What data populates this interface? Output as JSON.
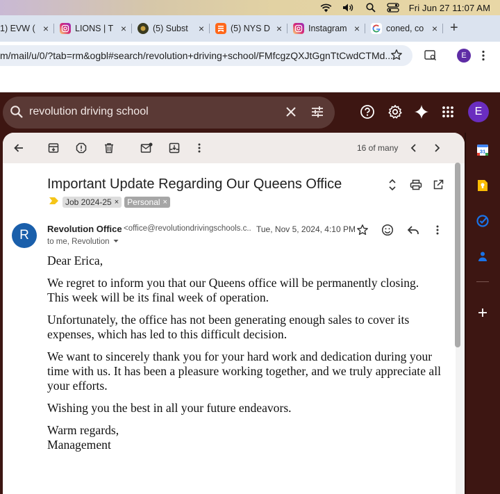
{
  "menubar": {
    "clock": "Fri Jun 27  11:07 AM"
  },
  "tabs": [
    {
      "label": "1) EVW (",
      "favicon": "",
      "favicon_color": "",
      "close": "×"
    },
    {
      "label": "LIONS | T",
      "favicon": "instagram-icon",
      "favicon_color": "#d6249f",
      "close": "×"
    },
    {
      "label": "(5) Subst",
      "favicon": "circle-logo-icon",
      "favicon_color": "#3a3a20",
      "close": "×"
    },
    {
      "label": "(5) NYS D",
      "favicon": "substack-icon",
      "favicon_color": "#ff6719",
      "close": "×"
    },
    {
      "label": "Instagram",
      "favicon": "instagram-icon",
      "favicon_color": "#d6249f",
      "close": "×"
    },
    {
      "label": "coned, co",
      "favicon": "google-icon",
      "favicon_color": "#4285f4",
      "close": "×"
    }
  ],
  "address": {
    "url": "m/mail/u/0/?tab=rm&ogbl#search/revolution+driving+school/FMfcgzQXJtGgnTtCwdCTMd..."
  },
  "profile": {
    "initial": "E"
  },
  "search": {
    "query": "revolution driving school"
  },
  "toolbar": {
    "pager": "16 of many"
  },
  "email": {
    "subject": "Important Update Regarding Our Queens Office",
    "labels": [
      {
        "name": "Job 2024-25"
      },
      {
        "name": "Personal"
      }
    ],
    "sender_initial": "R",
    "sender_name": "Revolution Office",
    "sender_email": "<office@revolutiondrivingschools.c...",
    "date": "Tue, Nov 5, 2024, 4:10 PM",
    "to": "to me, Revolution",
    "body": [
      "Dear Erica,",
      "We regret to inform you that our Queens office will be permanently closing. This week will be its final week of operation.",
      "Unfortunately, the office has not been generating enough sales to cover its expenses, which has led to this difficult decision.",
      "We want to sincerely thank you for your hard work and dedication during your time with us. It has been a pleasure working together, and we truly appreciate all your efforts.",
      "Wishing you the best in all your future endeavors.",
      "Warm regards,",
      "Management"
    ]
  },
  "sidepanel": {
    "calendar_day": "31"
  },
  "colors": {
    "gmail_bg": "#3d1612",
    "search_bg": "#5a3935",
    "sender_avatar": "#1a5fab",
    "profile_avatar": "#6a2dbf",
    "label_marker": "#f5c518"
  }
}
